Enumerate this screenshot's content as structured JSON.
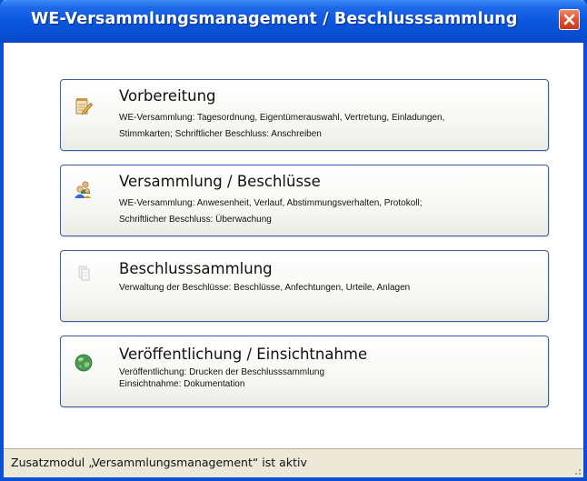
{
  "window": {
    "title": "WE-Versammlungsmanagement / Beschlusssammlung",
    "title_color": "#0a55dc"
  },
  "cards": [
    {
      "title": "Vorbereitung",
      "icon": "notepad-pencil-icon",
      "lines": [
        "WE-Versammlung: Tagesordnung, Eigentümerauswahl, Vertretung, Einladungen,",
        "Stimmkarten; Schriftlicher Beschluss: Anschreiben"
      ]
    },
    {
      "title": "Versammlung / Beschlüsse",
      "icon": "people-group-icon",
      "lines": [
        "WE-Versammlung: Anwesenheit, Verlauf, Abstimmungsverhalten, Protokoll;",
        "Schriftlicher Beschluss: Überwachung"
      ]
    },
    {
      "title": "Beschlusssammlung",
      "icon": "documents-icon",
      "lines": [
        "Verwaltung der Beschlüsse: Beschlüsse, Anfechtungen, Urteile, Anlagen"
      ]
    },
    {
      "title": "Veröffentlichung / Einsichtnahme",
      "icon": "globe-icon",
      "lines": [
        "Veröffentlichung: Drucken der Beschlusssammlung",
        "Einsichtnahme: Dokumentation"
      ]
    }
  ],
  "statusbar": {
    "text": "Zusatzmodul „Versammlungsmanagement“ ist aktiv"
  },
  "colors": {
    "card_border": "#3a5ea8",
    "statusbar_bg": "#ece9d8",
    "close_button": "#e0502b"
  }
}
